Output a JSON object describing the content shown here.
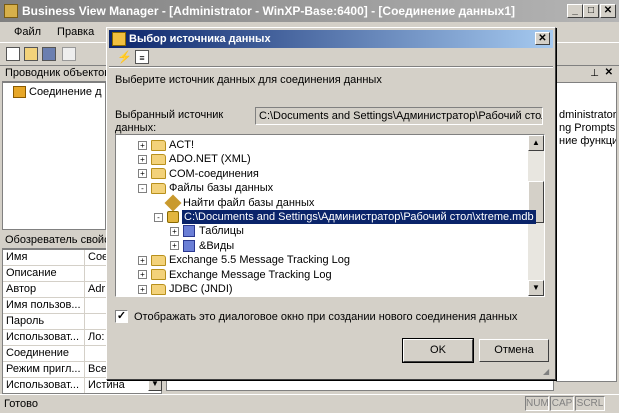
{
  "app": {
    "title": "Business View Manager - [Administrator - WinXP-Base:6400] - [Соединение данных1]",
    "menu": [
      "Файл",
      "Правка"
    ],
    "explorer_title": "Проводник объектов",
    "explorer_node": "Соединение д",
    "properties_title": "Обозреватель свойств",
    "properties": [
      {
        "key": "Имя",
        "value": "Сое"
      },
      {
        "key": "Описание",
        "value": ""
      },
      {
        "key": "Автор",
        "value": "Adr"
      },
      {
        "key": "Имя пользов...",
        "value": ""
      },
      {
        "key": "Пароль",
        "value": ""
      },
      {
        "key": "Использоват...",
        "value": "Ло:"
      },
      {
        "key": "Соединение",
        "value": ""
      },
      {
        "key": "Режим пригл...",
        "value": "Все"
      },
      {
        "key": "Использоват...",
        "value": "Истина"
      }
    ],
    "right_pane_lines": [
      "dministrator]",
      "ng Prompts",
      "ние функции"
    ],
    "status_text": "Готово",
    "status_indicators": [
      "NUM",
      "CAP",
      "SCRL"
    ]
  },
  "dialog": {
    "title": "Выбор источника данных",
    "close_glyph": "✕",
    "instruction": "Выберите источник данных для соединения данных",
    "selected_source_label": "Выбранный источник данных:",
    "selected_source_value": "C:\\Documents and Settings\\Администратор\\Рабочий стол\\xtreme.mdb",
    "tree": [
      {
        "label": "ACT!",
        "level": 0,
        "expander": "+",
        "icon": "folder-icon"
      },
      {
        "label": "ADO.NET (XML)",
        "level": 0,
        "expander": "+",
        "icon": "folder-icon"
      },
      {
        "label": "COM-соединения",
        "level": 0,
        "expander": "+",
        "icon": "folder-icon"
      },
      {
        "label": "Файлы базы данных",
        "level": 0,
        "expander": "-",
        "icon": "folder-icon"
      },
      {
        "label": "Найти файл базы данных",
        "level": 1,
        "expander": "",
        "icon": "wand-icon"
      },
      {
        "label": "C:\\Documents and Settings\\Администратор\\Рабочий стол\\xtreme.mdb",
        "level": 1,
        "expander": "-",
        "icon": "database-icon",
        "selected": true
      },
      {
        "label": "Таблицы",
        "level": 2,
        "expander": "+",
        "icon": "table-icon"
      },
      {
        "label": "&Виды",
        "level": 2,
        "expander": "+",
        "icon": "table-icon"
      },
      {
        "label": "Exchange 5.5 Message Tracking Log",
        "level": 0,
        "expander": "+",
        "icon": "folder-icon"
      },
      {
        "label": "Exchange Message Tracking Log",
        "level": 0,
        "expander": "+",
        "icon": "folder-icon"
      },
      {
        "label": "JDBC (JNDI)",
        "level": 0,
        "expander": "+",
        "icon": "folder-icon"
      }
    ],
    "checkbox_label": "Отображать это диалоговое окно при создании нового соединения данных",
    "checkbox_checked": true,
    "ok_label": "OK",
    "cancel_label": "Отмена"
  }
}
